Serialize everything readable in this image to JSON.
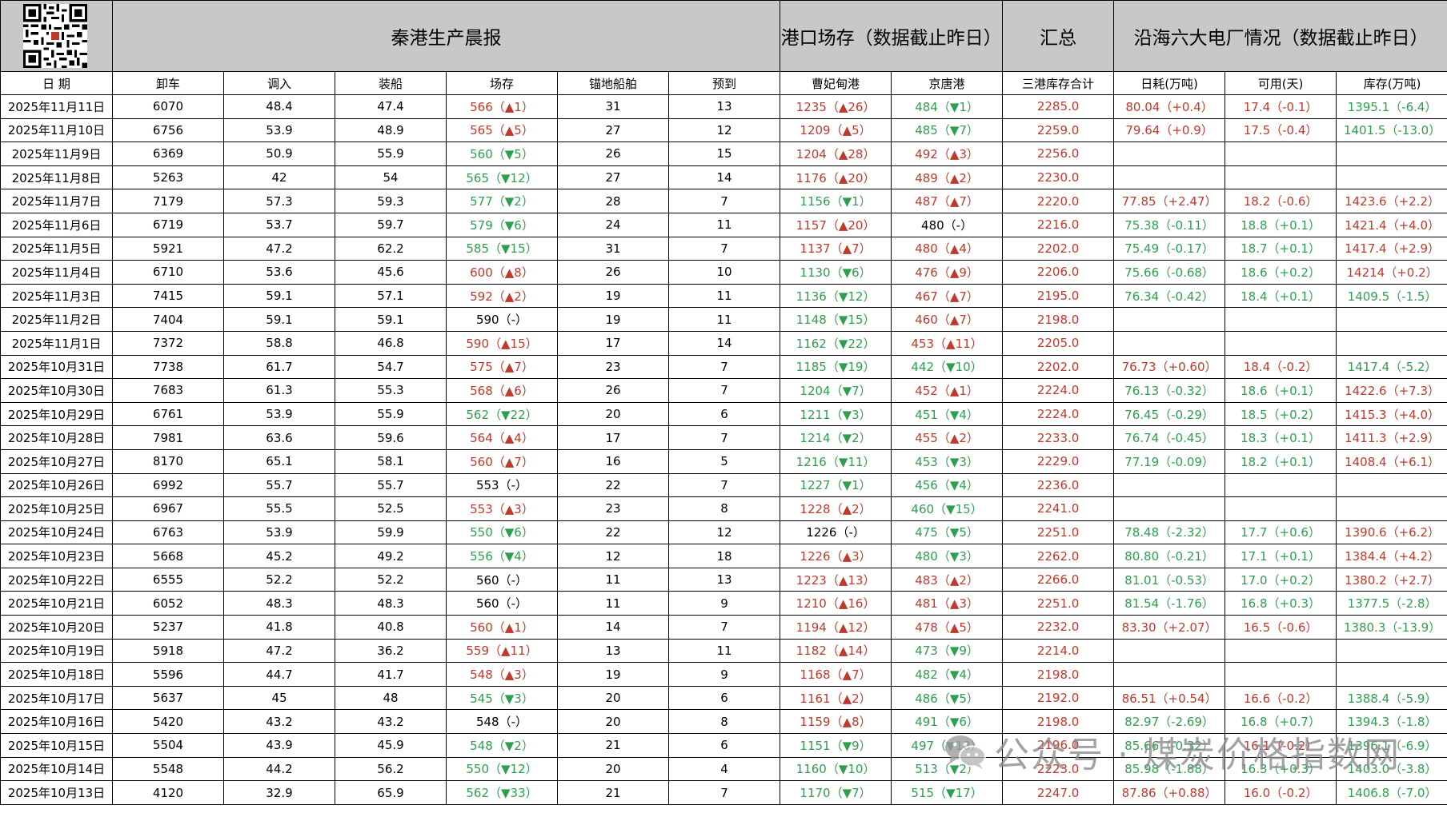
{
  "header": {
    "title": "秦港生产晨报",
    "port_stock_title": "港口场存（数据截止昨日）",
    "summary_title": "汇总",
    "plants_title": "沿海六大电厂情况（数据截止昨日）"
  },
  "columns": [
    "日 期",
    "卸车",
    "调入",
    "装船",
    "场存",
    "锚地船舶",
    "预到",
    "曹妃甸港",
    "京唐港",
    "三港库存合计",
    "日耗(万吨)",
    "可用(天)",
    "库存(万吨)"
  ],
  "rows": [
    [
      "2025年11月11日",
      "6070",
      "48.4",
      "47.4",
      "566（▲1）",
      "31",
      "13",
      "1235（▲26）",
      "484（▼1）",
      "2285.0",
      "80.04（+0.4）",
      "17.4（-0.1）",
      "1395.1（-6.4）"
    ],
    [
      "2025年11月10日",
      "6756",
      "53.9",
      "48.9",
      "565（▲5）",
      "27",
      "12",
      "1209（▲5）",
      "485（▼7）",
      "2259.0",
      "79.64（+0.9）",
      "17.5（-0.4）",
      "1401.5（-13.0）"
    ],
    [
      "2025年11月9日",
      "6369",
      "50.9",
      "55.9",
      "560（▼5）",
      "26",
      "15",
      "1204（▲28）",
      "492（▲3）",
      "2256.0",
      "",
      "",
      ""
    ],
    [
      "2025年11月8日",
      "5263",
      "42",
      "54",
      "565（▼12）",
      "27",
      "14",
      "1176（▲20）",
      "489（▲2）",
      "2230.0",
      "",
      "",
      ""
    ],
    [
      "2025年11月7日",
      "7179",
      "57.3",
      "59.3",
      "577（▼2）",
      "28",
      "7",
      "1156（▼1）",
      "487（▲7）",
      "2220.0",
      "77.85（+2.47）",
      "18.2（-0.6）",
      "1423.6（+2.2）"
    ],
    [
      "2025年11月6日",
      "6719",
      "53.7",
      "59.7",
      "579（▼6）",
      "24",
      "11",
      "1157（▲20）",
      "480（-）",
      "2216.0",
      "75.38（-0.11）",
      "18.8（+0.1）",
      "1421.4（+4.0）"
    ],
    [
      "2025年11月5日",
      "5921",
      "47.2",
      "62.2",
      "585（▼15）",
      "31",
      "7",
      "1137（▲7）",
      "480（▲4）",
      "2202.0",
      "75.49（-0.17）",
      "18.7（+0.1）",
      "1417.4（+2.9）"
    ],
    [
      "2025年11月4日",
      "6710",
      "53.6",
      "45.6",
      "600（▲8）",
      "26",
      "10",
      "1130（▼6）",
      "476（▲9）",
      "2206.0",
      "75.66（-0.68）",
      "18.6（+0.2）",
      "14214（+0.2）"
    ],
    [
      "2025年11月3日",
      "7415",
      "59.1",
      "57.1",
      "592（▲2）",
      "19",
      "11",
      "1136（▼12）",
      "467（▲7）",
      "2195.0",
      "76.34（-0.42）",
      "18.4（+0.1）",
      "1409.5（-1.5）"
    ],
    [
      "2025年11月2日",
      "7404",
      "59.1",
      "59.1",
      "590（-）",
      "19",
      "11",
      "1148（▼15）",
      "460（▲7）",
      "2198.0",
      "",
      "",
      ""
    ],
    [
      "2025年11月1日",
      "7372",
      "58.8",
      "46.8",
      "590（▲15）",
      "17",
      "14",
      "1162（▼22）",
      "453（▲11）",
      "2205.0",
      "",
      "",
      ""
    ],
    [
      "2025年10月31日",
      "7738",
      "61.7",
      "54.7",
      "575（▲7）",
      "23",
      "7",
      "1185（▼19）",
      "442（▼10）",
      "2202.0",
      "76.73（+0.60）",
      "18.4（-0.2）",
      "1417.4（-5.2）"
    ],
    [
      "2025年10月30日",
      "7683",
      "61.3",
      "55.3",
      "568（▲6）",
      "26",
      "7",
      "1204（▼7）",
      "452（▲1）",
      "2224.0",
      "76.13（-0.32）",
      "18.6（+0.1）",
      "1422.6（+7.3）"
    ],
    [
      "2025年10月29日",
      "6761",
      "53.9",
      "55.9",
      "562（▼22）",
      "20",
      "6",
      "1211（▼3）",
      "451（▼4）",
      "2224.0",
      "76.45（-0.29）",
      "18.5（+0.2）",
      "1415.3（+4.0）"
    ],
    [
      "2025年10月28日",
      "7981",
      "63.6",
      "59.6",
      "564（▲4）",
      "17",
      "7",
      "1214（▼2）",
      "455（▲2）",
      "2233.0",
      "76.74（-0.45）",
      "18.3（+0.1）",
      "1411.3（+2.9）"
    ],
    [
      "2025年10月27日",
      "8170",
      "65.1",
      "58.1",
      "560（▲7）",
      "16",
      "5",
      "1216（▼11）",
      "453（▼3）",
      "2229.0",
      "77.19（-0.09）",
      "18.2（+0.1）",
      "1408.4（+6.1）"
    ],
    [
      "2025年10月26日",
      "6992",
      "55.7",
      "55.7",
      "553（-）",
      "22",
      "7",
      "1227（▼1）",
      "456（▼4）",
      "2236.0",
      "",
      "",
      ""
    ],
    [
      "2025年10月25日",
      "6967",
      "55.5",
      "52.5",
      "553（▲3）",
      "23",
      "8",
      "1228（▲2）",
      "460（▼15）",
      "2241.0",
      "",
      "",
      ""
    ],
    [
      "2025年10月24日",
      "6763",
      "53.9",
      "59.9",
      "550（▼6）",
      "22",
      "12",
      "1226（-）",
      "475（▼5）",
      "2251.0",
      "78.48（-2.32）",
      "17.7（+0.6）",
      "1390.6（+6.2）"
    ],
    [
      "2025年10月23日",
      "5668",
      "45.2",
      "49.2",
      "556（▼4）",
      "12",
      "18",
      "1226（▲3）",
      "480（▼3）",
      "2262.0",
      "80.80（-0.21）",
      "17.1（+0.1）",
      "1384.4（+4.2）"
    ],
    [
      "2025年10月22日",
      "6555",
      "52.2",
      "52.2",
      "560（-）",
      "11",
      "13",
      "1223（▲13）",
      "483（▲2）",
      "2266.0",
      "81.01（-0.53）",
      "17.0（+0.2）",
      "1380.2（+2.7）"
    ],
    [
      "2025年10月21日",
      "6052",
      "48.3",
      "48.3",
      "560（-）",
      "11",
      "9",
      "1210（▲16）",
      "481（▲3）",
      "2251.0",
      "81.54（-1.76）",
      "16.8（+0.3）",
      "1377.5（-2.8）"
    ],
    [
      "2025年10月20日",
      "5237",
      "41.8",
      "40.8",
      "560（▲1）",
      "14",
      "7",
      "1194（▲12）",
      "478（▲5）",
      "2232.0",
      "83.30（+2.07）",
      "16.5（-0.6）",
      "1380.3（-13.9）"
    ],
    [
      "2025年10月19日",
      "5918",
      "47.2",
      "36.2",
      "559（▲11）",
      "13",
      "11",
      "1182（▲14）",
      "473（▼9）",
      "2214.0",
      "",
      "",
      ""
    ],
    [
      "2025年10月18日",
      "5596",
      "44.7",
      "41.7",
      "548（▲3）",
      "19",
      "9",
      "1168（▲7）",
      "482（▼4）",
      "2198.0",
      "",
      "",
      ""
    ],
    [
      "2025年10月17日",
      "5637",
      "45",
      "48",
      "545（▼3）",
      "20",
      "6",
      "1161（▲2）",
      "486（▼5）",
      "2192.0",
      "86.51（+0.54）",
      "16.6（-0.2）",
      "1388.4（-5.9）"
    ],
    [
      "2025年10月16日",
      "5420",
      "43.2",
      "43.2",
      "548（-）",
      "20",
      "8",
      "1159（▲8）",
      "491（▼6）",
      "2198.0",
      "82.97（-2.69）",
      "16.8（+0.7）",
      "1394.3（-1.8）"
    ],
    [
      "2025年10月15日",
      "5504",
      "43.9",
      "45.9",
      "548（▼2）",
      "21",
      "6",
      "1151（▼9）",
      "497（▼18）",
      "2196.0",
      "85.66（-0.32）",
      "16.1（-0.2）",
      "1396.1（-6.9）"
    ],
    [
      "2025年10月14日",
      "5548",
      "44.2",
      "56.2",
      "550（▼12）",
      "20",
      "4",
      "1160（▼10）",
      "513（▼2）",
      "2223.0",
      "85.98（-1.88）",
      "16.3（+0.3）",
      "1403.0（-3.8）"
    ],
    [
      "2025年10月13日",
      "4120",
      "32.9",
      "65.9",
      "562（▼33）",
      "21",
      "7",
      "1170（▼7）",
      "515（▼17）",
      "2247.0",
      "87.86（+0.88）",
      "16.0（-0.2）",
      "1406.8（-7.0）"
    ]
  ],
  "watermark": "公众号 · 煤炭价格指数网",
  "colors": {
    "up": "#c0392b",
    "down": "#2e9e4f",
    "header_bg": "#c8c8c8"
  },
  "icons": {
    "qr": "qr-code-icon",
    "wechat": "wechat-icon"
  }
}
